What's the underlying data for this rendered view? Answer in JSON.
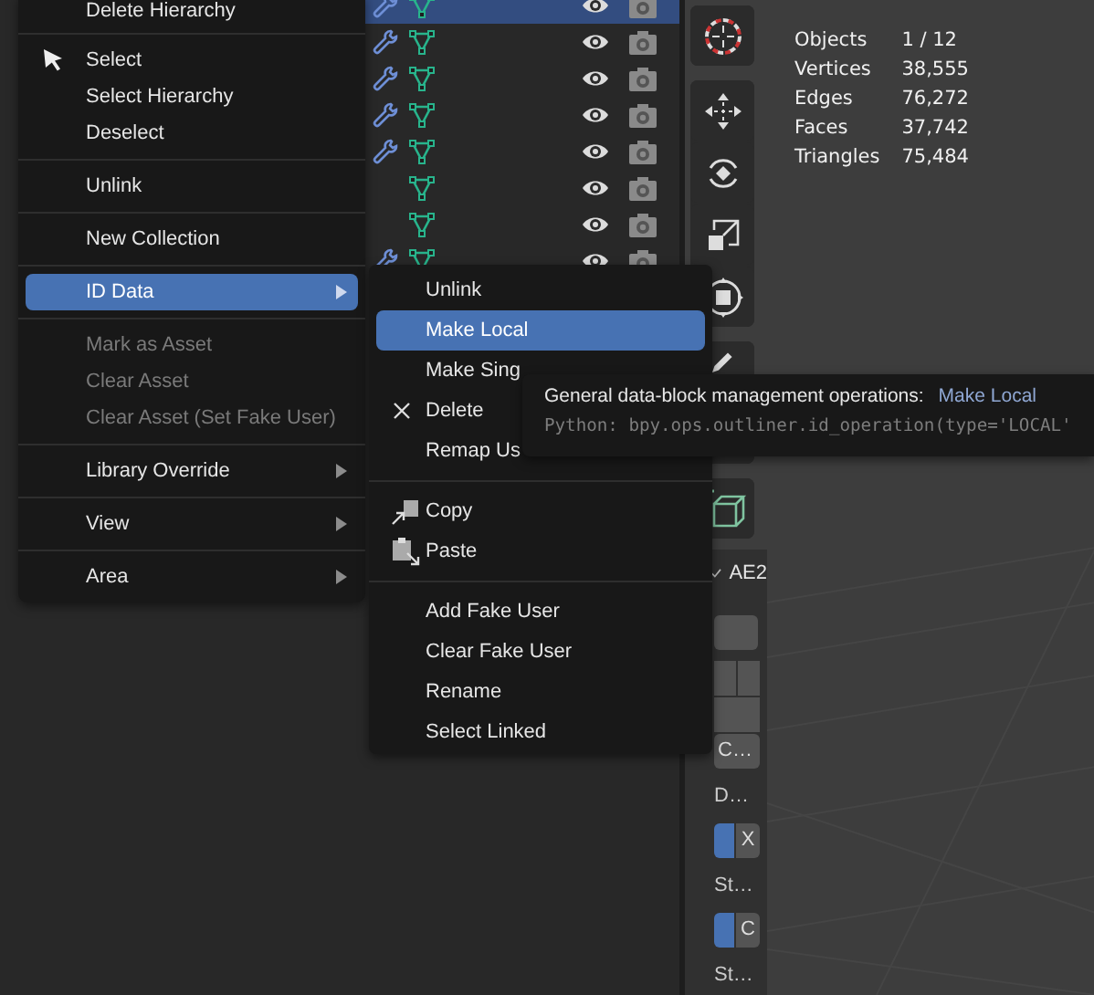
{
  "outliner": {
    "rows": [
      {
        "selected": true,
        "modifier": true
      },
      {
        "selected": false,
        "modifier": true
      },
      {
        "selected": false,
        "modifier": true
      },
      {
        "selected": false,
        "modifier": true
      },
      {
        "selected": false,
        "modifier": true
      },
      {
        "selected": false,
        "modifier": false
      },
      {
        "selected": false,
        "modifier": false
      },
      {
        "selected": false,
        "modifier": true
      }
    ]
  },
  "context_menu": {
    "sections": [
      [
        {
          "label": "Delete Hierarchy",
          "selected": false,
          "disabled": false,
          "submenu": false
        }
      ],
      [
        {
          "label": "Select",
          "selected": false,
          "disabled": false,
          "submenu": false
        },
        {
          "label": "Select Hierarchy",
          "selected": false,
          "disabled": false,
          "submenu": false
        },
        {
          "label": "Deselect",
          "selected": false,
          "disabled": false,
          "submenu": false
        }
      ],
      [
        {
          "label": "Unlink",
          "selected": false,
          "disabled": false,
          "submenu": false
        }
      ],
      [
        {
          "label": "New Collection",
          "selected": false,
          "disabled": false,
          "submenu": false
        }
      ],
      [
        {
          "label": "ID Data",
          "selected": true,
          "disabled": false,
          "submenu": true
        }
      ],
      [
        {
          "label": "Mark as Asset",
          "selected": false,
          "disabled": true,
          "submenu": false
        },
        {
          "label": "Clear Asset",
          "selected": false,
          "disabled": true,
          "submenu": false
        },
        {
          "label": "Clear Asset (Set Fake User)",
          "selected": false,
          "disabled": true,
          "submenu": false
        }
      ],
      [
        {
          "label": "Library Override",
          "selected": false,
          "disabled": false,
          "submenu": true
        }
      ],
      [
        {
          "label": "View",
          "selected": false,
          "disabled": false,
          "submenu": true
        }
      ],
      [
        {
          "label": "Area",
          "selected": false,
          "disabled": false,
          "submenu": true
        }
      ]
    ]
  },
  "submenu": {
    "sections": [
      [
        {
          "label": "Unlink",
          "selected": false
        },
        {
          "label": "Make Local",
          "selected": true
        },
        {
          "label": "Make Sing",
          "selected": false
        },
        {
          "label": "Delete",
          "selected": false
        },
        {
          "label": "Remap Us",
          "selected": false
        }
      ],
      [
        {
          "label": "Copy",
          "selected": false
        },
        {
          "label": "Paste",
          "selected": false
        }
      ],
      [
        {
          "label": "Add Fake User",
          "selected": false
        },
        {
          "label": "Clear Fake User",
          "selected": false
        },
        {
          "label": "Rename",
          "selected": false
        },
        {
          "label": "Select Linked",
          "selected": false
        }
      ]
    ]
  },
  "tooltip": {
    "description": "General data-block management operations:",
    "operation": "Make Local",
    "python": "Python: bpy.ops.outliner.id_operation(type='LOCAL'"
  },
  "panel": {
    "items": [
      {
        "kind": "check",
        "label": "AE2"
      },
      {
        "kind": "button"
      },
      {
        "kind": "split"
      },
      {
        "kind": "button",
        "label": "C…"
      },
      {
        "kind": "text",
        "label": "D…"
      },
      {
        "kind": "toggle",
        "label": "X",
        "on": true
      },
      {
        "kind": "text",
        "label": "St…"
      },
      {
        "kind": "toggle",
        "label": "C",
        "on": true
      },
      {
        "kind": "text",
        "label": "St…"
      }
    ]
  },
  "stats": [
    {
      "label": "Objects",
      "value": "1 / 12"
    },
    {
      "label": "Vertices",
      "value": "38,555"
    },
    {
      "label": "Edges",
      "value": "76,272"
    },
    {
      "label": "Faces",
      "value": "37,742"
    },
    {
      "label": "Triangles",
      "value": "75,484"
    }
  ]
}
